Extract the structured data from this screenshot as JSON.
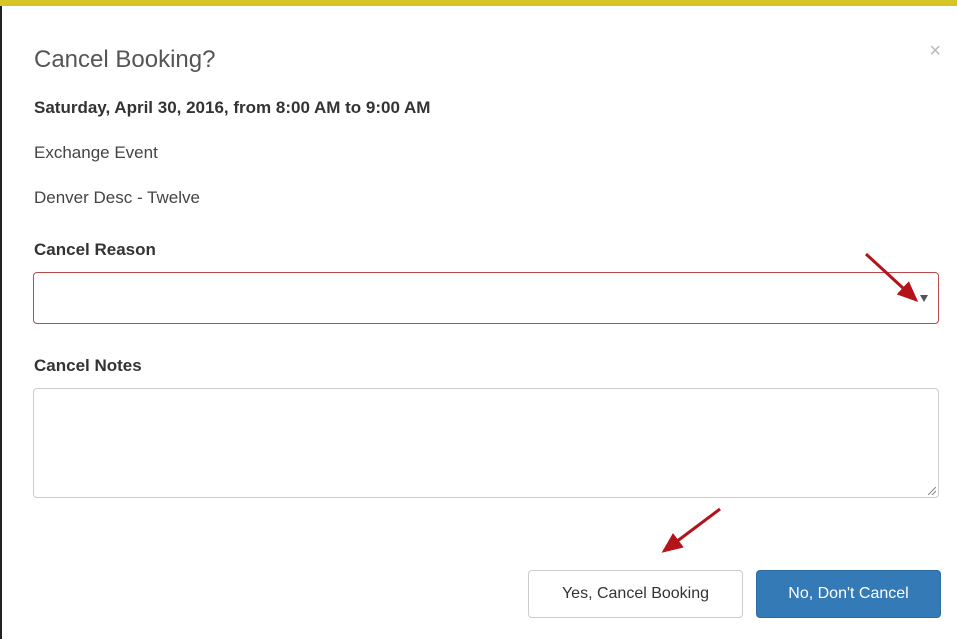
{
  "modal": {
    "title": "Cancel Booking?",
    "close_symbol": "×",
    "date_line": "Saturday, April 30, 2016, from 8:00 AM to 9:00 AM",
    "event_name": "Exchange Event",
    "resource_name": "Denver Desc - Twelve"
  },
  "form": {
    "reason_label": "Cancel Reason",
    "reason_value": "",
    "notes_label": "Cancel Notes",
    "notes_value": ""
  },
  "buttons": {
    "yes_label": "Yes, Cancel Booking",
    "no_label": "No, Don't Cancel"
  },
  "colors": {
    "top_bar": "#d7c426",
    "error_border": "#b94a48",
    "primary_button": "#337ab7",
    "annotation_arrow": "#b3141a"
  },
  "icons": {
    "close": "close-icon",
    "dropdown": "caret-down-icon",
    "annotations": "arrow-annotation"
  }
}
